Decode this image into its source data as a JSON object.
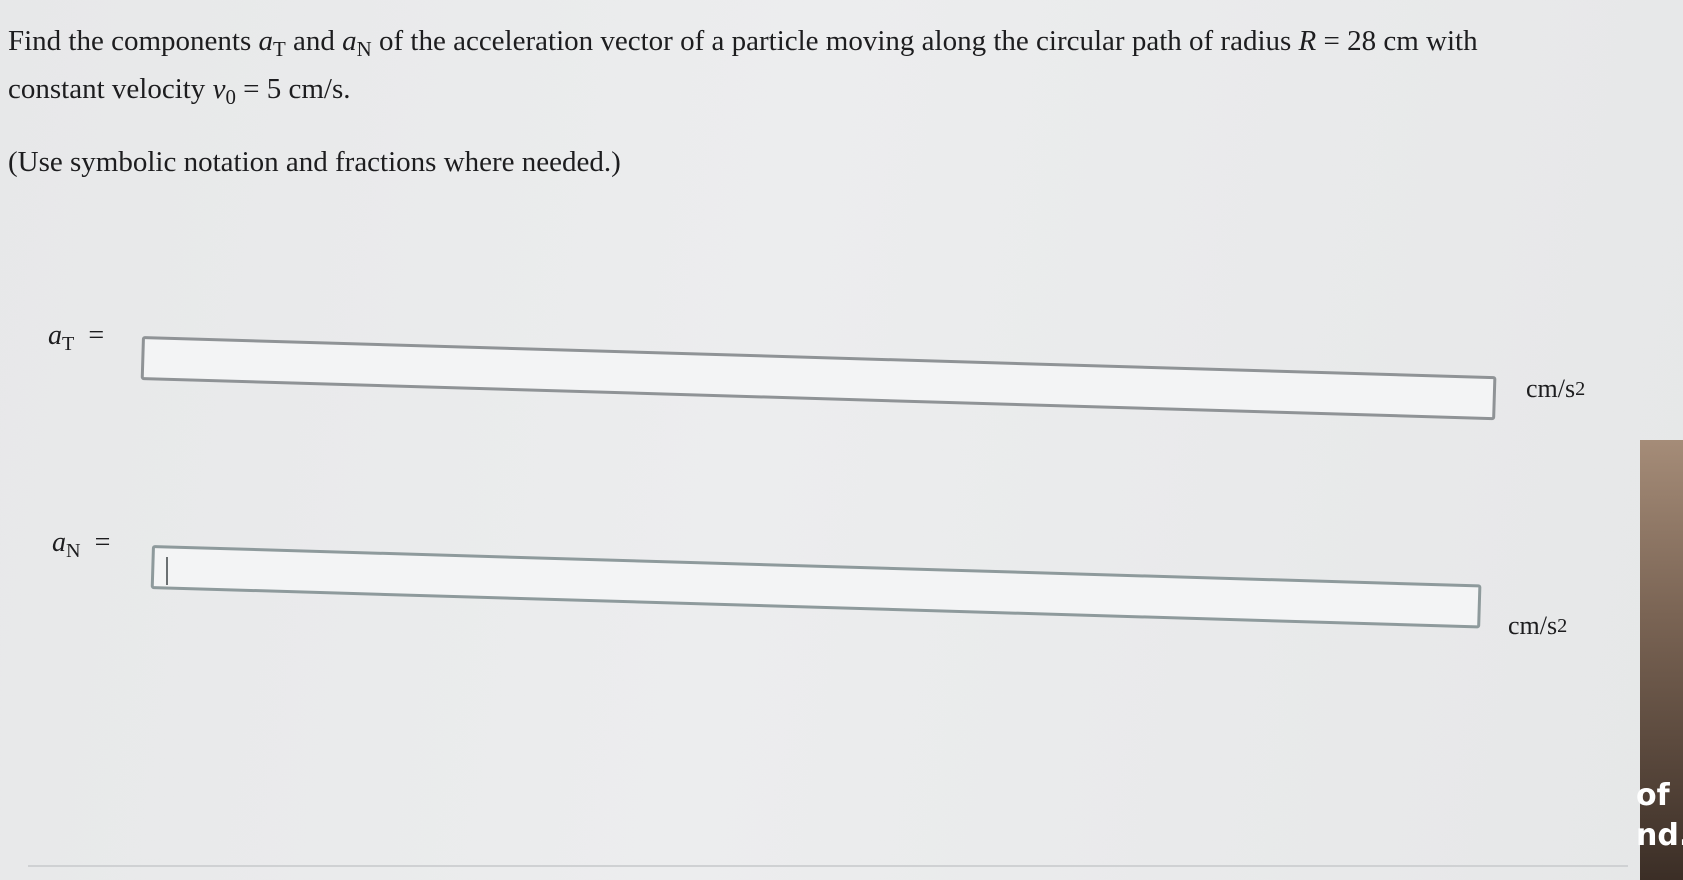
{
  "question": {
    "line1_intro": "Find the components",
    "aT_symbol": "a",
    "aT_sub": "T",
    "conjunction": "and",
    "aN_symbol": "a",
    "aN_sub": "N",
    "line1_rest": "of the acceleration vector of a particle moving along the circular path of radius",
    "radius_symbol": "R",
    "radius_eq": "= 28 cm with",
    "line2_intro": "constant velocity",
    "velocity_symbol": "v",
    "velocity_sub": "0",
    "velocity_eq": "= 5 cm/s."
  },
  "instruction": "(Use symbolic notation and fractions where needed.)",
  "answers": [
    {
      "symbol": "a",
      "sub": "T",
      "equals": "=",
      "value": "",
      "unit": "cm/s",
      "unit_exp": "2"
    },
    {
      "symbol": "a",
      "sub": "N",
      "equals": "=",
      "value": "",
      "unit": "cm/s",
      "unit_exp": "2"
    }
  ],
  "resize_icon": "⇔",
  "edge_text": {
    "line1": "of",
    "line2": "nd."
  }
}
